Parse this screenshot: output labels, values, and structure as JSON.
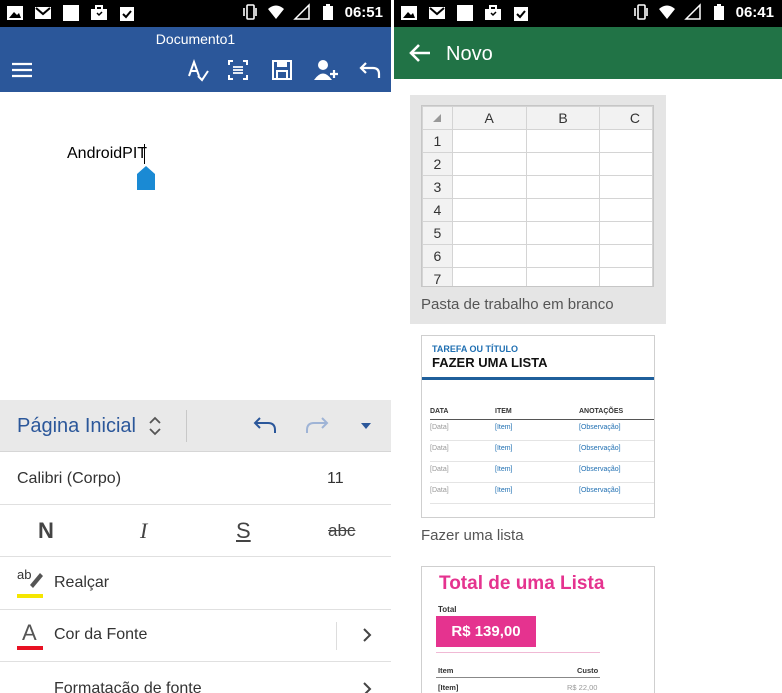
{
  "left": {
    "status_time": "06:51",
    "doc_title": "Documento1",
    "document_text": "AndroidPIT",
    "ribbon": {
      "tab_label": "Página Inicial"
    },
    "font": {
      "name": "Calibri (Corpo)",
      "size": "11"
    },
    "format_buttons": {
      "bold": "N",
      "italic": "I",
      "underline": "S",
      "strike": "abc"
    },
    "highlight_icon_text": "ab",
    "rows": {
      "highlight": "Realçar",
      "font_color": "Cor da Fonte",
      "font_format": "Formatação de fonte"
    },
    "colors": {
      "appbar": "#2b579a",
      "highlight": "#f5e600",
      "font_color": "#e81123"
    }
  },
  "right": {
    "status_time": "06:41",
    "title": "Novo",
    "blank_workbook": {
      "columns": [
        "A",
        "B",
        "C"
      ],
      "rows": [
        "1",
        "2",
        "3",
        "4",
        "5",
        "6",
        "7"
      ],
      "label": "Pasta de trabalho em branco"
    },
    "list_template": {
      "subtitle": "TAREFA OU TÍTULO",
      "title": "FAZER UMA LISTA",
      "headers": [
        "DATA",
        "ITEM",
        "ANOTAÇÕES"
      ],
      "rows": [
        [
          "[Data]",
          "[Item]",
          "[Observação]"
        ],
        [
          "[Data]",
          "[Item]",
          "[Observação]"
        ],
        [
          "[Data]",
          "[Item]",
          "[Observação]"
        ],
        [
          "[Data]",
          "[Item]",
          "[Observação]"
        ]
      ],
      "label": "Fazer uma lista"
    },
    "total_template": {
      "title": "Total de uma Lista",
      "total_label": "Total",
      "total_value": "R$ 139,00",
      "item_header": "Item",
      "cost_header": "Custo",
      "first_item": "[Item]",
      "first_cost": "R$ 22,00"
    },
    "colors": {
      "appbar": "#217346",
      "accent_pink": "#e5338f"
    }
  }
}
